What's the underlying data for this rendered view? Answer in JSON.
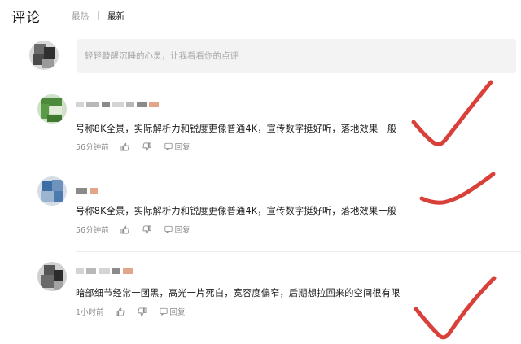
{
  "header": {
    "title": "评论",
    "tab_hot": "最热",
    "tab_new": "最新"
  },
  "input": {
    "placeholder": "轻轻敲醒沉睡的心灵，让我看看你的点评"
  },
  "comments": [
    {
      "text": "号称8K全景，实际解析力和锐度更像普通4K，宣传数字挺好听，落地效果一般",
      "time": "56分钟前",
      "reply": "回复"
    },
    {
      "text": "号称8K全景，实际解析力和锐度更像普通4K，宣传数字挺好听，落地效果一般",
      "time": "56分钟前",
      "reply": "回复"
    },
    {
      "text": "暗部细节经常一团黑，高光一片死白，宽容度偏窄，后期想拉回来的空间很有限",
      "time": "1小时前",
      "reply": "回复"
    }
  ],
  "icons": {
    "like": "thumbs-up-icon",
    "dislike": "thumbs-down-icon",
    "reply": "comment-icon"
  },
  "colors": {
    "checkmark": "#d9403a",
    "divider": "#ececec",
    "input_bg": "#f3f3f3"
  }
}
